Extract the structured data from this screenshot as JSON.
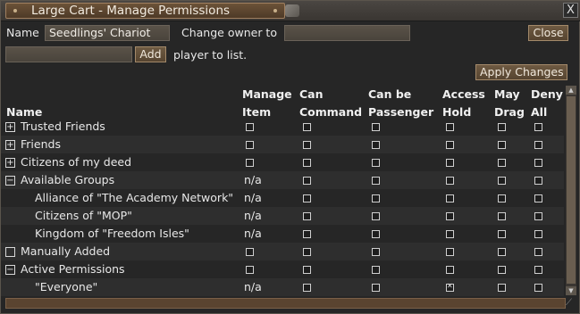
{
  "window": {
    "title": "Large Cart - Manage Permissions",
    "close_glyph": "X"
  },
  "top": {
    "name_label": "Name",
    "name_value": "Seedlings' Chariot",
    "change_owner_label": "Change owner to",
    "change_owner_value": "",
    "close_label": "Close",
    "add_player_value": "",
    "add_label": "Add",
    "player_to_list_label": "player to list.",
    "apply_label": "Apply Changes"
  },
  "columns": {
    "name": "Name",
    "manage": [
      "Manage",
      "Item"
    ],
    "command": [
      "Can",
      "Command"
    ],
    "passenger": [
      "Can be",
      "Passenger"
    ],
    "access": [
      "Access",
      "Hold"
    ],
    "drag": [
      "May",
      "Drag"
    ],
    "deny": [
      "Deny",
      "All"
    ]
  },
  "rows": [
    {
      "label": "Trusted Friends",
      "expander": "+",
      "indent": 0,
      "manage": "box",
      "checks": [
        false,
        false,
        false,
        false,
        false
      ]
    },
    {
      "label": "Friends",
      "expander": "+",
      "indent": 0,
      "manage": "box",
      "checks": [
        false,
        false,
        false,
        false,
        false
      ]
    },
    {
      "label": "Citizens of my deed",
      "expander": "+",
      "indent": 0,
      "manage": "box",
      "checks": [
        false,
        false,
        false,
        false,
        false
      ]
    },
    {
      "label": "Available Groups",
      "expander": "−",
      "indent": 0,
      "manage": "n/a",
      "checks": [
        false,
        false,
        false,
        false,
        false
      ]
    },
    {
      "label": "Alliance of \"The Academy Network\"",
      "expander": "",
      "indent": 1,
      "manage": "n/a",
      "checks": [
        false,
        false,
        false,
        false,
        false
      ]
    },
    {
      "label": "Citizens of \"MOP\"",
      "expander": "",
      "indent": 1,
      "manage": "n/a",
      "checks": [
        false,
        false,
        false,
        false,
        false
      ]
    },
    {
      "label": "Kingdom of \"Freedom Isles\"",
      "expander": "",
      "indent": 1,
      "manage": "n/a",
      "checks": [
        false,
        false,
        false,
        false,
        false
      ]
    },
    {
      "label": "Manually Added",
      "expander": "",
      "indent": 0,
      "manage": "box",
      "checks": [
        false,
        false,
        false,
        false,
        false
      ]
    },
    {
      "label": "Active Permissions",
      "expander": "−",
      "indent": 0,
      "manage": "box",
      "checks": [
        false,
        false,
        false,
        false,
        false
      ]
    },
    {
      "label": "\"Everyone\"",
      "expander": "",
      "indent": 1,
      "manage": "n/a",
      "checks": [
        false,
        false,
        true,
        false,
        false
      ]
    }
  ]
}
